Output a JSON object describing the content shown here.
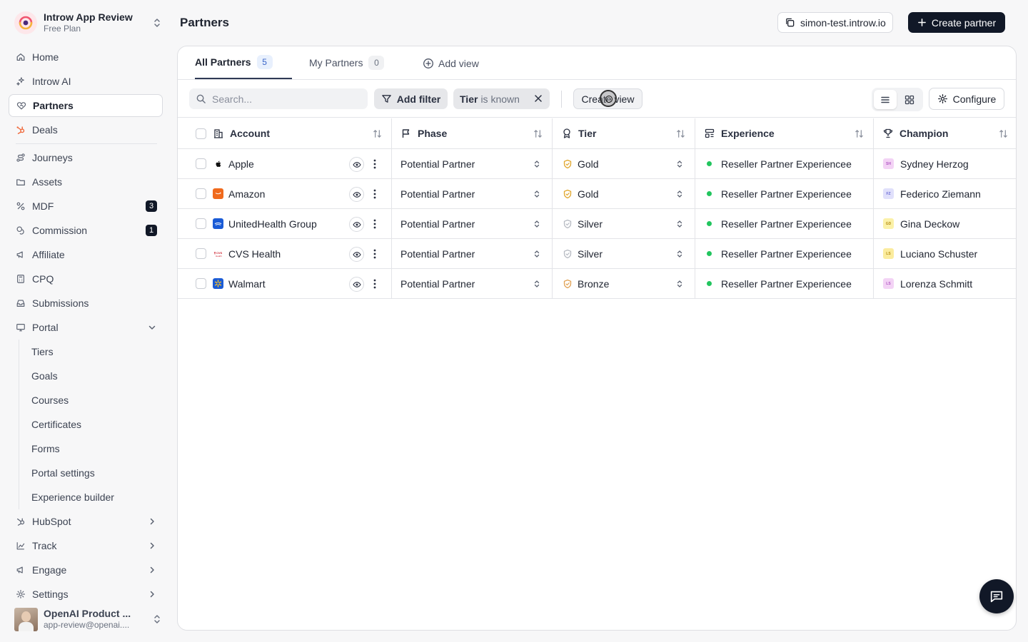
{
  "workspace": {
    "name": "Introw App Review",
    "plan": "Free Plan"
  },
  "page": {
    "title": "Partners"
  },
  "header": {
    "domain": "simon-test.introw.io",
    "create_label": "Create partner"
  },
  "sidebar": {
    "items": [
      {
        "label": "Home",
        "icon": "home-icon"
      },
      {
        "label": "Introw AI",
        "icon": "sparkle-icon"
      },
      {
        "label": "Partners",
        "icon": "handshake-icon",
        "active": true
      },
      {
        "label": "Deals",
        "icon": "hubspot-icon"
      },
      {
        "label": "Journeys",
        "icon": "route-icon"
      },
      {
        "label": "Assets",
        "icon": "folder-icon"
      },
      {
        "label": "MDF",
        "icon": "percent-icon",
        "badge": "3"
      },
      {
        "label": "Commission",
        "icon": "coins-icon",
        "badge": "1"
      },
      {
        "label": "Affiliate",
        "icon": "megaphone-icon"
      },
      {
        "label": "CPQ",
        "icon": "calculator-icon"
      },
      {
        "label": "Submissions",
        "icon": "inbox-icon"
      },
      {
        "label": "Portal",
        "icon": "monitor-icon"
      }
    ],
    "portal_sub": [
      "Tiers",
      "Goals",
      "Courses",
      "Certificates",
      "Forms",
      "Portal settings",
      "Experience builder"
    ],
    "groups": [
      {
        "label": "HubSpot",
        "icon": "hubspot-icon"
      },
      {
        "label": "Track",
        "icon": "chart-icon"
      },
      {
        "label": "Engage",
        "icon": "megaphone-icon"
      },
      {
        "label": "Settings",
        "icon": "gear-icon"
      }
    ]
  },
  "user": {
    "name": "OpenAI Product ...",
    "email": "app-review@openai...."
  },
  "tabs": [
    {
      "label": "All Partners",
      "count": "5"
    },
    {
      "label": "My Partners",
      "count": "0"
    },
    {
      "label": "Add view"
    }
  ],
  "toolbar": {
    "search_placeholder": "Search...",
    "add_filter": "Add filter",
    "chip_field": "Tier",
    "chip_op": "is known",
    "create_view": "Create view",
    "configure": "Configure"
  },
  "table": {
    "columns": [
      "Account",
      "Phase",
      "Tier",
      "Experience",
      "Champion"
    ],
    "rows": [
      {
        "account": "Apple",
        "logo": "apple",
        "phase": "Potential Partner",
        "tier": "Gold",
        "tier_color": "#e0a52a",
        "experience": "Reseller Partner Experiencee",
        "champion": "Sydney Herzog",
        "initials": "SH",
        "init_bg": "#f3d3f5",
        "init_fg": "#b157c4"
      },
      {
        "account": "Amazon",
        "logo": "amazon",
        "phase": "Potential Partner",
        "tier": "Gold",
        "tier_color": "#e0a52a",
        "experience": "Reseller Partner Experiencee",
        "champion": "Federico Ziemann",
        "initials": "FZ",
        "init_bg": "#e0e0fb",
        "init_fg": "#6b6bd6"
      },
      {
        "account": "UnitedHealth Group",
        "logo": "uhg",
        "phase": "Potential Partner",
        "tier": "Silver",
        "tier_color": "#b6bac2",
        "experience": "Reseller Partner Experiencee",
        "champion": "Gina Deckow",
        "initials": "GD",
        "init_bg": "#fbf1a8",
        "init_fg": "#b58d12"
      },
      {
        "account": "CVS Health",
        "logo": "cvs",
        "phase": "Potential Partner",
        "tier": "Silver",
        "tier_color": "#b6bac2",
        "experience": "Reseller Partner Experiencee",
        "champion": "Luciano Schuster",
        "initials": "LS",
        "init_bg": "#fbec9e",
        "init_fg": "#b58d12"
      },
      {
        "account": "Walmart",
        "logo": "walmart",
        "phase": "Potential Partner",
        "tier": "Bronze",
        "tier_color": "#e0a052",
        "experience": "Reseller Partner Experiencee",
        "champion": "Lorenza Schmitt",
        "initials": "LS",
        "init_bg": "#f3d3f5",
        "init_fg": "#b157c4"
      }
    ]
  },
  "colors": {
    "accent": "#111827",
    "active_tab_count": "#3b66c9",
    "status_dot": "#22c55e"
  }
}
